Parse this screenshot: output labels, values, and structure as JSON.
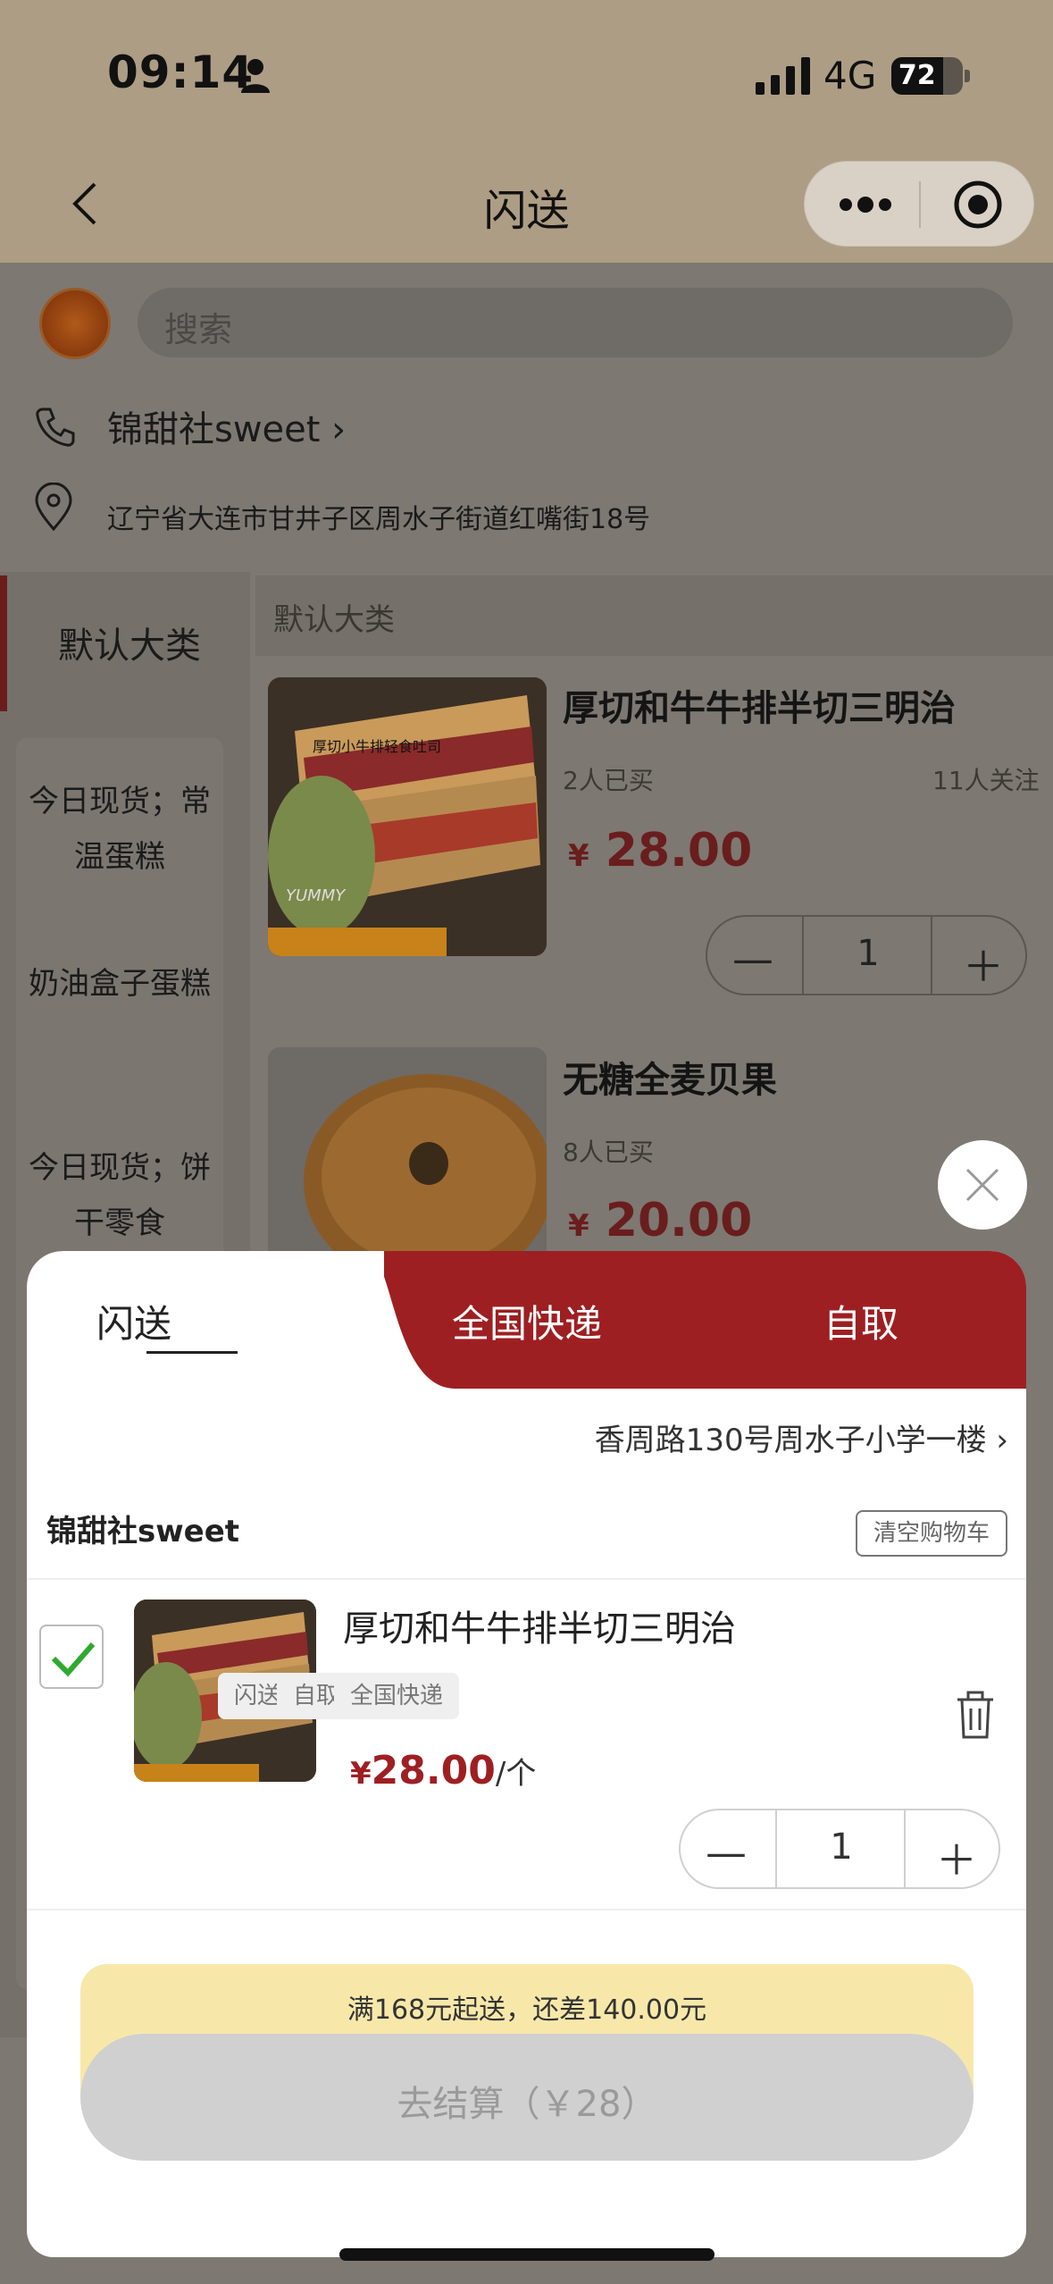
{
  "status": {
    "time": "09:14",
    "network": "4G",
    "battery": "72",
    "battery_level": 0.72
  },
  "nav": {
    "title": "闪送"
  },
  "search": {
    "placeholder": "搜索"
  },
  "shop": {
    "name": "锦甜社sweet",
    "address": "辽宁省大连市甘井子区周水子街道红嘴街18号"
  },
  "categories": {
    "main": "默认大类",
    "sub": [
      "今日现货；常温蛋糕",
      "奶油盒子蛋糕",
      "今日现货；饼干零食"
    ]
  },
  "products": {
    "section": "默认大类",
    "items": [
      {
        "name": "厚切和牛牛排半切三明治",
        "bought": "2人已买",
        "follow": "11人关注",
        "currency": "¥",
        "price": "28.00",
        "qty": "1",
        "img_text": "厚切小牛排轻食吐司",
        "img_text2": "YUMMY"
      },
      {
        "name": "无糖全麦贝果",
        "bought": "8人已买",
        "currency": "¥",
        "price": "20.00"
      }
    ]
  },
  "cart": {
    "tabs": [
      "闪送",
      "全国快递",
      "自取"
    ],
    "address": "香周路130号周水子小学一楼",
    "store": "锦甜社sweet",
    "clear_label": "清空购物车",
    "item": {
      "name": "厚切和牛牛排半切三明治",
      "chips": [
        "闪送",
        "自取",
        "全国快递"
      ],
      "currency": "¥",
      "price": "28.00",
      "unit": "/个",
      "qty": "1"
    },
    "notice": "满168元起送，还差140.00元",
    "checkout": "去结算（￥28）"
  },
  "colors": {
    "brand_red": "#9e1f22",
    "check_green": "#2eaa2e",
    "notice_bg": "#f7e8aa"
  }
}
